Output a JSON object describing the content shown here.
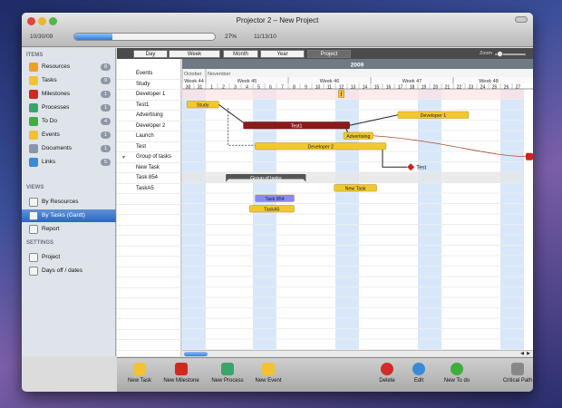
{
  "window": {
    "title": "Projector 2 – New Project",
    "date_start": "10/30/09",
    "date_end": "11/13/10",
    "progress": 0.27,
    "progress_label": "27%"
  },
  "sidebar": {
    "items_header": "ITEMS",
    "items": [
      {
        "label": "Resources",
        "badge": "8",
        "icon": "star-icon",
        "color": "#f0a020"
      },
      {
        "label": "Tasks",
        "badge": "9",
        "icon": "tasks-icon",
        "color": "#f2c230"
      },
      {
        "label": "Milestones",
        "badge": "1",
        "icon": "flag-icon",
        "color": "#d02a20"
      },
      {
        "label": "Processes",
        "badge": "1",
        "icon": "process-icon",
        "color": "#3aa56a"
      },
      {
        "label": "To Do",
        "badge": "4",
        "icon": "checkmark-icon",
        "color": "#3fae3f"
      },
      {
        "label": "Events",
        "badge": "1",
        "icon": "exclamation-icon",
        "color": "#f2c230"
      },
      {
        "label": "Documents",
        "badge": "1",
        "icon": "paperclip-icon",
        "color": "#8a96a8"
      },
      {
        "label": "Links",
        "badge": "5",
        "icon": "link-icon",
        "color": "#3a8ad8"
      }
    ],
    "views_header": "VIEWS",
    "views": [
      {
        "label": "By Resources",
        "icon": "person-icon"
      },
      {
        "label": "By Tasks (Gantt)",
        "icon": "gantt-icon",
        "selected": true
      },
      {
        "label": "Report",
        "icon": "report-icon"
      }
    ],
    "settings_header": "SETTINGS",
    "settings": [
      {
        "label": "Project",
        "icon": "project-icon"
      },
      {
        "label": "Days off / dates",
        "icon": "calendar-icon"
      }
    ]
  },
  "tabs": {
    "items": [
      "Day",
      "Week",
      "Month",
      "Year",
      "Project"
    ],
    "active": "Project",
    "zoom_label": "Zoom"
  },
  "task_rows": [
    {
      "label": "Events"
    },
    {
      "label": "Study"
    },
    {
      "label": "Developer 1"
    },
    {
      "label": "Test1"
    },
    {
      "label": "Advertising"
    },
    {
      "label": "Developer 2"
    },
    {
      "label": "Launch"
    },
    {
      "label": "Test"
    },
    {
      "label": "Group of tasks",
      "disclosure": "▼"
    },
    {
      "label": "New Task"
    },
    {
      "label": "Task 854"
    },
    {
      "label": "TaskA5"
    }
  ],
  "timeline": {
    "year": "2009",
    "months": [
      {
        "label": "October",
        "start_day_index": 0
      },
      {
        "label": "November",
        "start_day_index": 2
      }
    ],
    "weeks": [
      {
        "label": "Week 44",
        "start_day_index": 0
      },
      {
        "label": "Week 45",
        "start_day_index": 2
      },
      {
        "label": "Week 46",
        "start_day_index": 9
      },
      {
        "label": "Week 47",
        "start_day_index": 16
      },
      {
        "label": "Week 48",
        "start_day_index": 23
      }
    ],
    "days": [
      "30",
      "31",
      "1",
      "2",
      "3",
      "4",
      "5",
      "6",
      "7",
      "8",
      "9",
      "10",
      "11",
      "12",
      "13",
      "14",
      "15",
      "16",
      "17",
      "18",
      "19",
      "20",
      "21",
      "22",
      "23",
      "24",
      "25",
      "26",
      "27"
    ],
    "weekend_day_indices": [
      0,
      1,
      6,
      7,
      13,
      14,
      20,
      21,
      27,
      28
    ]
  },
  "bars": [
    {
      "row": 1,
      "label": "Study",
      "start": 0.4,
      "end": 3.1,
      "kind": "task",
      "color": "#f2c830"
    },
    {
      "row": 2,
      "label": "Developer 1",
      "start": 18.3,
      "end": 24.3,
      "kind": "task",
      "color": "#f2c830"
    },
    {
      "row": 3,
      "label": "Test1",
      "start": 5.2,
      "end": 14.2,
      "kind": "process",
      "color": "#8b1a1a"
    },
    {
      "row": 4,
      "label": "Advertising",
      "start": 13.7,
      "end": 16.2,
      "kind": "task",
      "color": "#f2c830"
    },
    {
      "row": 5,
      "label": "Developer 2",
      "start": 6.2,
      "end": 17.3,
      "kind": "task",
      "color": "#f2c830"
    },
    {
      "row": 8,
      "label": "Group of tasks",
      "start": 3.7,
      "end": 10.5,
      "kind": "group",
      "color": "#555555"
    },
    {
      "row": 9,
      "label": "New Task",
      "start": 12.9,
      "end": 16.5,
      "kind": "task",
      "color": "#f2c830"
    },
    {
      "row": 10,
      "label": "Task 854",
      "start": 6.2,
      "end": 9.5,
      "kind": "task",
      "color": "#8a8af0"
    },
    {
      "row": 11,
      "label": "TaskA5",
      "start": 5.7,
      "end": 9.5,
      "kind": "task",
      "color": "#f2c830"
    }
  ],
  "milestones": [
    {
      "row": 7,
      "label": "Test",
      "at": 19.4,
      "color": "#d0201a"
    }
  ],
  "events": [
    {
      "row": 0,
      "at": 13.5,
      "label": "!"
    }
  ],
  "toolbar": {
    "buttons": [
      {
        "label": "New Task",
        "icon": "new-task-icon",
        "color": "#f2c230"
      },
      {
        "label": "New Milestone",
        "icon": "flag-icon",
        "color": "#d02a20"
      },
      {
        "label": "New Process",
        "icon": "process-icon",
        "color": "#3aa56a"
      },
      {
        "label": "New Event",
        "icon": "exclamation-icon",
        "color": "#f2c230"
      },
      {
        "label": "Delete",
        "icon": "delete-icon",
        "color": "#d42a2a"
      },
      {
        "label": "Edit",
        "icon": "info-icon",
        "color": "#3a8ad8"
      },
      {
        "label": "New To do",
        "icon": "checkmark-icon",
        "color": "#3fae3f"
      },
      {
        "label": "Critical Path",
        "icon": "critical-path-icon",
        "color": "#888888"
      }
    ]
  },
  "scroll_arrows": [
    "◀",
    "▶"
  ]
}
